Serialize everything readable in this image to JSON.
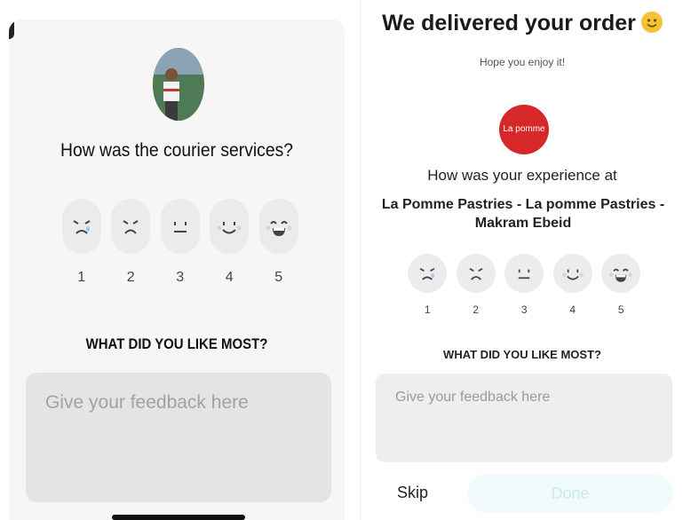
{
  "left_screen": {
    "question": "How was the courier services?",
    "ratings": [
      "1",
      "2",
      "3",
      "4",
      "5"
    ],
    "like_most": "WHAT DID YOU LIKE MOST?",
    "feedback_placeholder": "Give your feedback here"
  },
  "right_screen": {
    "title": "We delivered your order",
    "subtitle": "Hope you enjoy it!",
    "logo_text": "La pomme",
    "experience_question": "How was your experience at",
    "restaurant_name": "La Pomme Pastries - La pomme Pastries - Makram Ebeid",
    "ratings": [
      "1",
      "2",
      "3",
      "4",
      "5"
    ],
    "like_most": "WHAT DID YOU LIKE MOST?",
    "feedback_placeholder": "Give your feedback here",
    "skip_label": "Skip",
    "done_label": "Done"
  },
  "icons": {
    "faces": [
      "very-sad-face-icon",
      "sad-face-icon",
      "neutral-face-icon",
      "smile-face-icon",
      "laughing-face-icon"
    ],
    "title_emoji": "smiley-emoji-icon"
  },
  "colors": {
    "logo": "#d62828",
    "done_bg": "#f1fbfb",
    "done_text": "#c6ecec",
    "face_bg": "#ececec"
  }
}
